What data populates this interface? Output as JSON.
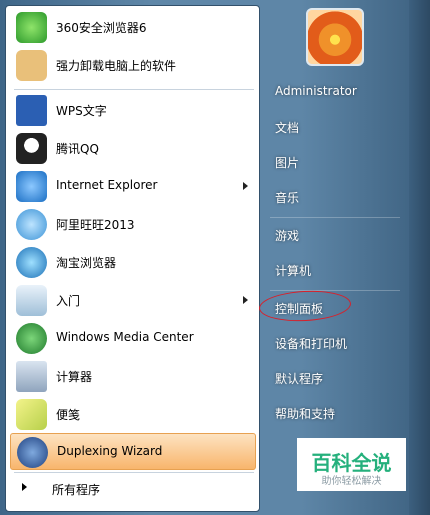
{
  "left_items": [
    {
      "label": "360安全浏览器6",
      "icon": "360-browser-icon",
      "color": "#3fae3a"
    },
    {
      "label": "强力卸载电脑上的软件",
      "icon": "uninstall-icon",
      "color": "#e9b86a"
    },
    {
      "label": "WPS文字",
      "icon": "wps-icon",
      "color": "#2b5fb3"
    },
    {
      "label": "腾讯QQ",
      "icon": "qq-icon",
      "color": "#222222"
    },
    {
      "label": "Internet Explorer",
      "icon": "ie-icon",
      "color": "#2f86d8"
    },
    {
      "label": "阿里旺旺2013",
      "icon": "aliwangwang-icon",
      "color": "#4aa5e8"
    },
    {
      "label": "淘宝浏览器",
      "icon": "taobao-browser-icon",
      "color": "#f27b1e"
    },
    {
      "label": "入门",
      "icon": "getting-started-icon",
      "color": "#5d9ac8"
    },
    {
      "label": "Windows Media Center",
      "icon": "media-center-icon",
      "color": "#2e8f3c"
    },
    {
      "label": "计算器",
      "icon": "calculator-icon",
      "color": "#8fa4bd"
    },
    {
      "label": "便笺",
      "icon": "sticky-notes-icon",
      "color": "#d7d85a"
    },
    {
      "label": "Duplexing Wizard",
      "icon": "duplexing-wizard-icon",
      "color": "#27509a"
    }
  ],
  "all_programs": "所有程序",
  "right_items": [
    "Administrator",
    "文档",
    "图片",
    "音乐",
    "游戏",
    "计算机",
    "控制面板",
    "设备和打印机",
    "默认程序",
    "帮助和支持"
  ],
  "watermark": {
    "big": "百科全说",
    "small": "助你轻松解决"
  }
}
